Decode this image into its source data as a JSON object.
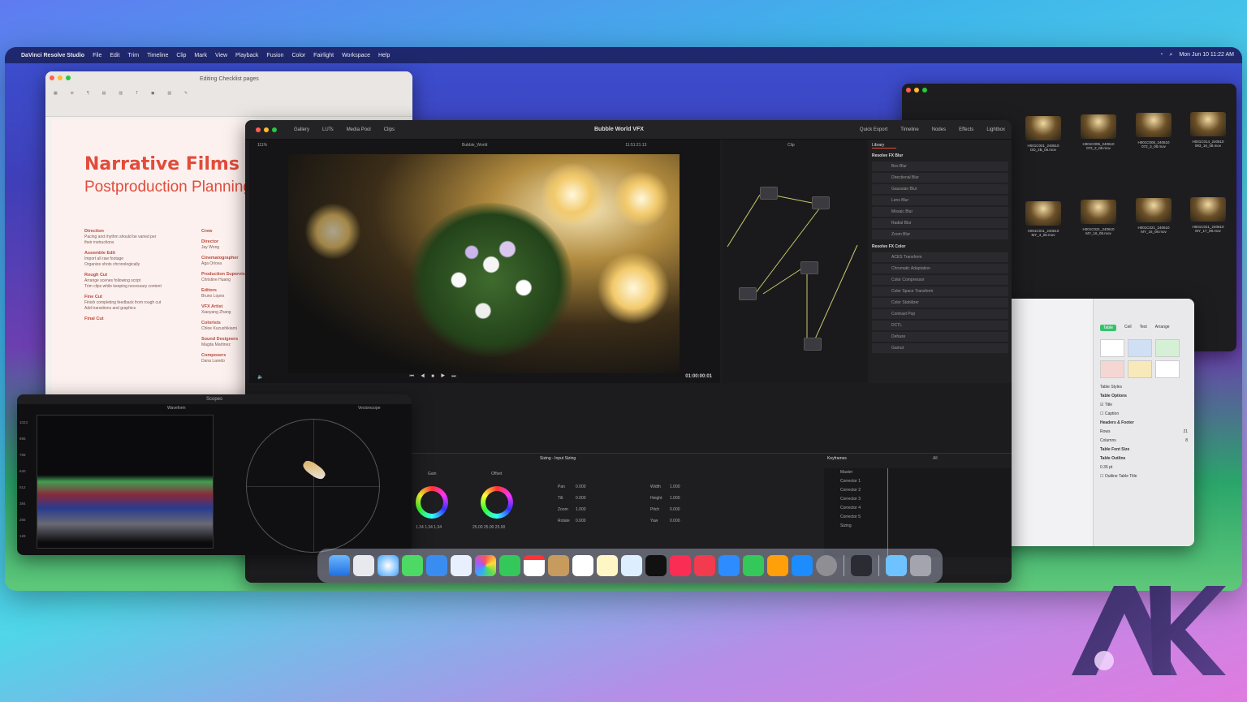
{
  "menubar": {
    "app": "DaVinci Resolve Studio",
    "items": [
      "File",
      "Edit",
      "Trim",
      "Timeline",
      "Clip",
      "Mark",
      "View",
      "Playback",
      "Fusion",
      "Color",
      "Fairlight",
      "Workspace",
      "Help"
    ],
    "datetime": "Mon Jun 10 11:22 AM"
  },
  "document": {
    "window_title": "Editing Checklist pages",
    "heading": "Narrative Films",
    "subheading": "Postproduction Planning",
    "left_sections": [
      {
        "title": "Direction",
        "lines": [
          "Pacing and rhythm should be varied per",
          "their instructions"
        ]
      },
      {
        "title": "Assemble Edit",
        "lines": [
          "Import all raw footage",
          "Organize shots chronologically"
        ]
      },
      {
        "title": "Rough Cut",
        "lines": [
          "Arrange scenes following script",
          "Trim clips while keeping necessary content"
        ]
      },
      {
        "title": "Fine Cut",
        "lines": [
          "Finish completing feedback from rough cut",
          "Add transitions and graphics"
        ]
      },
      {
        "title": "Final Cut",
        "lines": []
      }
    ],
    "crew": [
      {
        "role": "Crew",
        "name": ""
      },
      {
        "role": "Director",
        "name": "Jay Wong"
      },
      {
        "role": "Cinematographer",
        "name": "Aga Orlova"
      },
      {
        "role": "Production Supervisor",
        "name": "Christine Huang"
      },
      {
        "role": "Editors",
        "name": "Bruno Lopes"
      },
      {
        "role": "VFX Artist",
        "name": "Xiaoyang Zhang"
      },
      {
        "role": "Colorists",
        "name": "Chloe Kuzushikiami"
      },
      {
        "role": "Sound Designers",
        "name": "Magda Martinez"
      },
      {
        "role": "Composers",
        "name": "Dana Laredo"
      }
    ]
  },
  "resolve": {
    "title": "Bubble World VFX",
    "top_tabs": [
      "Gallery",
      "LUTs",
      "Media Pool",
      "Clips"
    ],
    "right_tabs": [
      "Quick Export",
      "Timeline",
      "Nodes",
      "Effects",
      "Lightbox"
    ],
    "clip_name": "Bubble_World",
    "zoom": "111%",
    "source_tc": "11:51:21:13",
    "clip_menu": "Clip",
    "timecode": "01:00:00:01",
    "library_tab": "Library",
    "fx_sections": [
      {
        "title": "Resolve FX Blur",
        "items": [
          "Box Blur",
          "Directional Blur",
          "Gaussian Blur",
          "Lens Blur",
          "Mosaic Blur",
          "Radial Blur",
          "Zoom Blur"
        ]
      },
      {
        "title": "Resolve FX Color",
        "items": [
          "ACES Transform",
          "Chromatic Adaptation",
          "Color Compressor",
          "Color Space Transform",
          "Color Stabilizer",
          "Contrast Pop",
          "DCTL",
          "Dehaze",
          "Gamut"
        ]
      }
    ],
    "wheels": [
      {
        "name": "Gain",
        "values": "1.34  1.34  1.34"
      },
      {
        "name": "Offset",
        "values": "25.00  25.00  25.00"
      }
    ],
    "sizing_title": "Sizing - Input Sizing",
    "sizing_fields": [
      {
        "label": "Pan",
        "value": "0.000"
      },
      {
        "label": "Tilt",
        "value": "0.000"
      },
      {
        "label": "Zoom",
        "value": "1.000"
      },
      {
        "label": "Rotate",
        "value": "0.000"
      }
    ],
    "sizing_fields_right": [
      {
        "label": "Width",
        "value": "1.000"
      },
      {
        "label": "Height",
        "value": "1.000"
      },
      {
        "label": "Pitch",
        "value": "0.000"
      },
      {
        "label": "Yaw",
        "value": "0.000"
      }
    ],
    "keyframes_title": "Keyframes",
    "keyframes_filter": "All",
    "keyframe_rows": [
      "Master",
      "Corrector 1",
      "Corrector 2",
      "Corrector 3",
      "Corrector 4",
      "Corrector 5",
      "Sizing"
    ]
  },
  "scopes": {
    "title": "Scopes",
    "left": "Waveform",
    "right": "Vectorscope",
    "scale": [
      "1023",
      "896",
      "768",
      "640",
      "512",
      "384",
      "256",
      "128",
      "0"
    ]
  },
  "finder": {
    "files": [
      "H001C001_240610 DD_2B_06.mov",
      "H001C005_240610 072_2_08.mov",
      "H001C005_240610 072_3_08.mov",
      "H001C014_240610 093_16_08.mov",
      "H001C011_240610 MY_4_08.mov",
      "H001C021_240610 MY_16_08.mov",
      "H001C021_240610 MY_16_08.mov",
      "H001C021_240610 MY_17_08.mov"
    ]
  },
  "numbers": {
    "tabs": [
      "Table",
      "Cell",
      "Text",
      "Arrange"
    ],
    "sections": [
      "Table Styles",
      "Table Options",
      "Headers & Footer",
      "Rows",
      "Columns",
      "Table Font Size",
      "Table Outline",
      "Outline Table Title"
    ],
    "options": [
      "Title",
      "Caption"
    ],
    "rows_value": "21",
    "cols_value": "8",
    "outline_size": "0.35 pt"
  },
  "logo": {
    "text": "AK"
  },
  "colors": {
    "accent_red": "#e14c3b",
    "resolve_bg": "#1c1c1f"
  }
}
